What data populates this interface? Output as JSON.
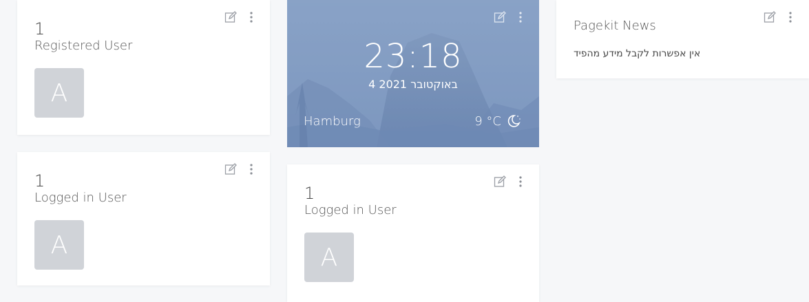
{
  "widgets": {
    "registered_users": {
      "count": "1",
      "label": "Registered User",
      "avatar_letter": "A"
    },
    "logged_in_users_left": {
      "count": "1",
      "label": "Logged in User",
      "avatar_letter": "A"
    },
    "clock": {
      "time": "23:18",
      "date": "4 2021 באוקטובר",
      "city": "Hamburg",
      "temperature": "9 °C",
      "weather_icon": "moon-icon"
    },
    "logged_in_users_center": {
      "count": "1",
      "label": "Logged in User",
      "avatar_letter": "A"
    },
    "news": {
      "title": "Pagekit News",
      "message": "אין אפשרות לקבל מידע מהפיד"
    }
  },
  "actions": {
    "edit_icon": "edit-icon",
    "more_icon": "more-vertical-icon"
  },
  "colors": {
    "background": "#f6f7f9",
    "panel": "#ffffff",
    "avatar": "#d0d3d8",
    "icon": "#9a9ea5",
    "clock_overlay": "#7c97bf"
  }
}
